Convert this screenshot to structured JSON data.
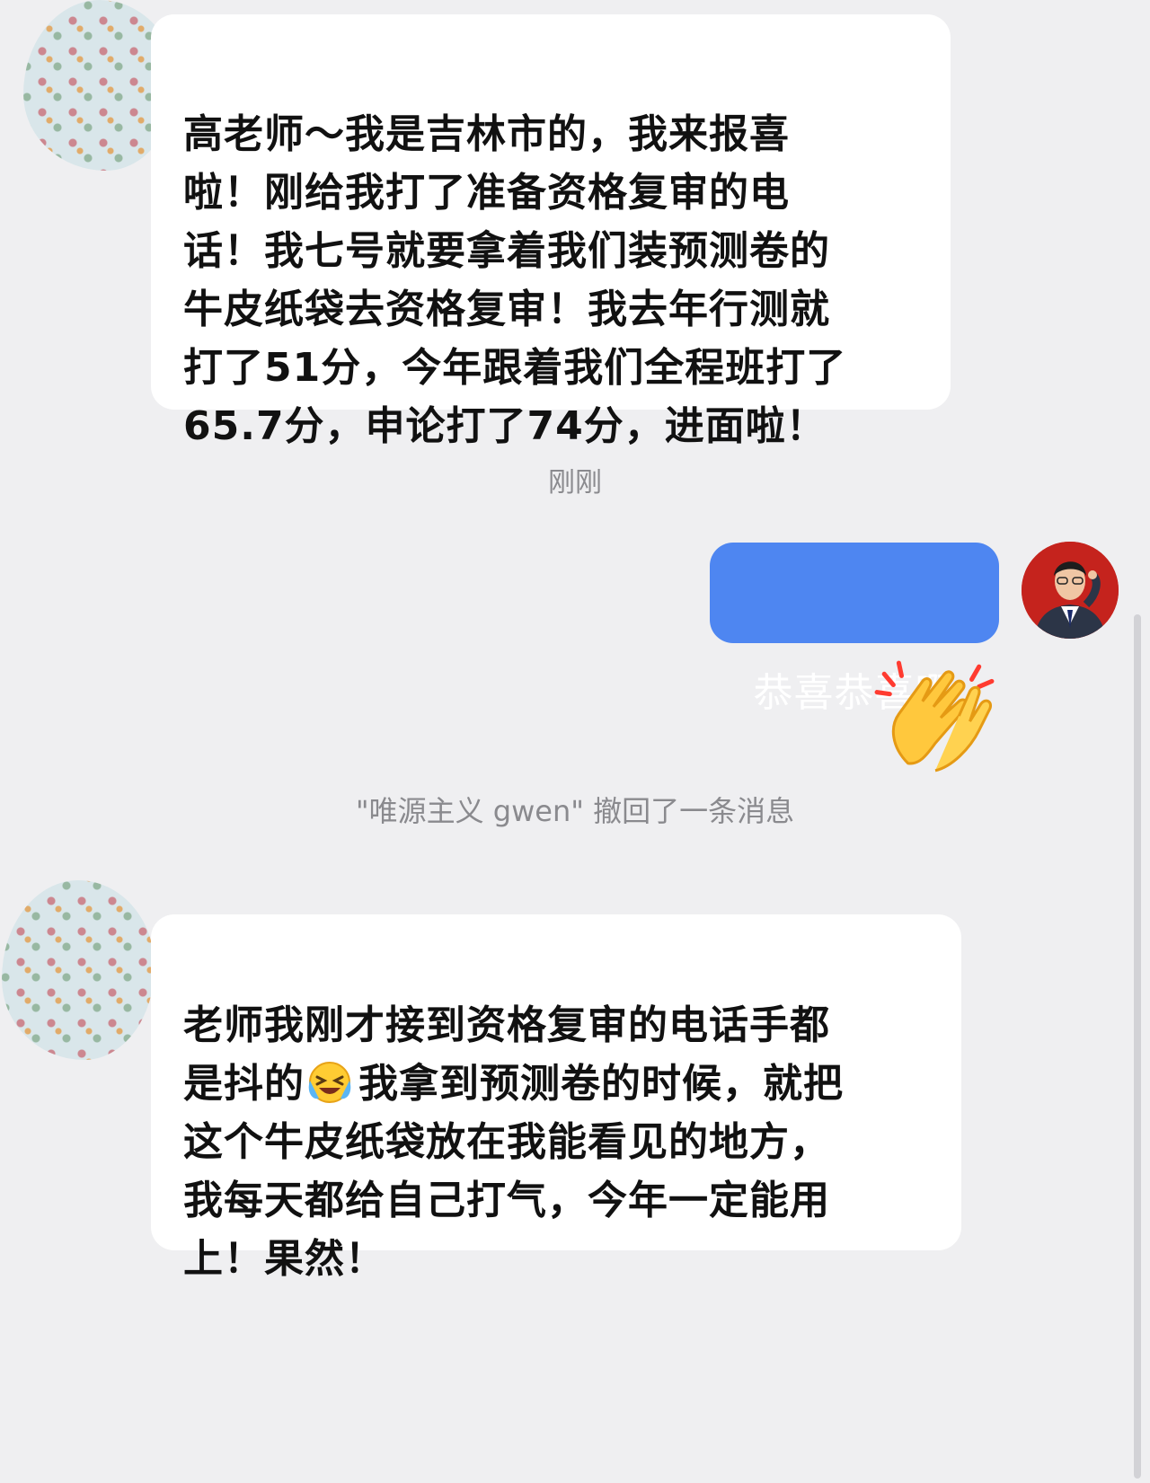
{
  "conversation": {
    "message1": "高老师～我是吉林市的，我来报喜\n啦！刚给我打了准备资格复审的电\n话！我七号就要拿着我们装预测卷的\n牛皮纸袋去资格复审！我去年行测就\n打了51分，今年跟着我们全程班打了\n 65.7分，申论打了74分，进面啦！",
    "timestamp": "刚刚",
    "reply": "恭喜恭喜啊",
    "reply_emoji": "clapping-hands-icon",
    "system_notice": "\"唯源主义 gwen\" 撤回了一条消息",
    "message2_part1": "老师我刚才接到资格复审的电话手都\n是抖的",
    "message2_emoji": "laughing-crying-icon",
    "message2_part2": "我拿到预测卷的时候，就把\n这个牛皮纸袋放在我能看见的地方，\n我每天都给自己打气，今年一定能用\n上！果然！"
  },
  "colors": {
    "background": "#efeff1",
    "bubble_incoming": "#ffffff",
    "bubble_outgoing": "#4e86f1",
    "meta_text": "#8a8a8e"
  }
}
